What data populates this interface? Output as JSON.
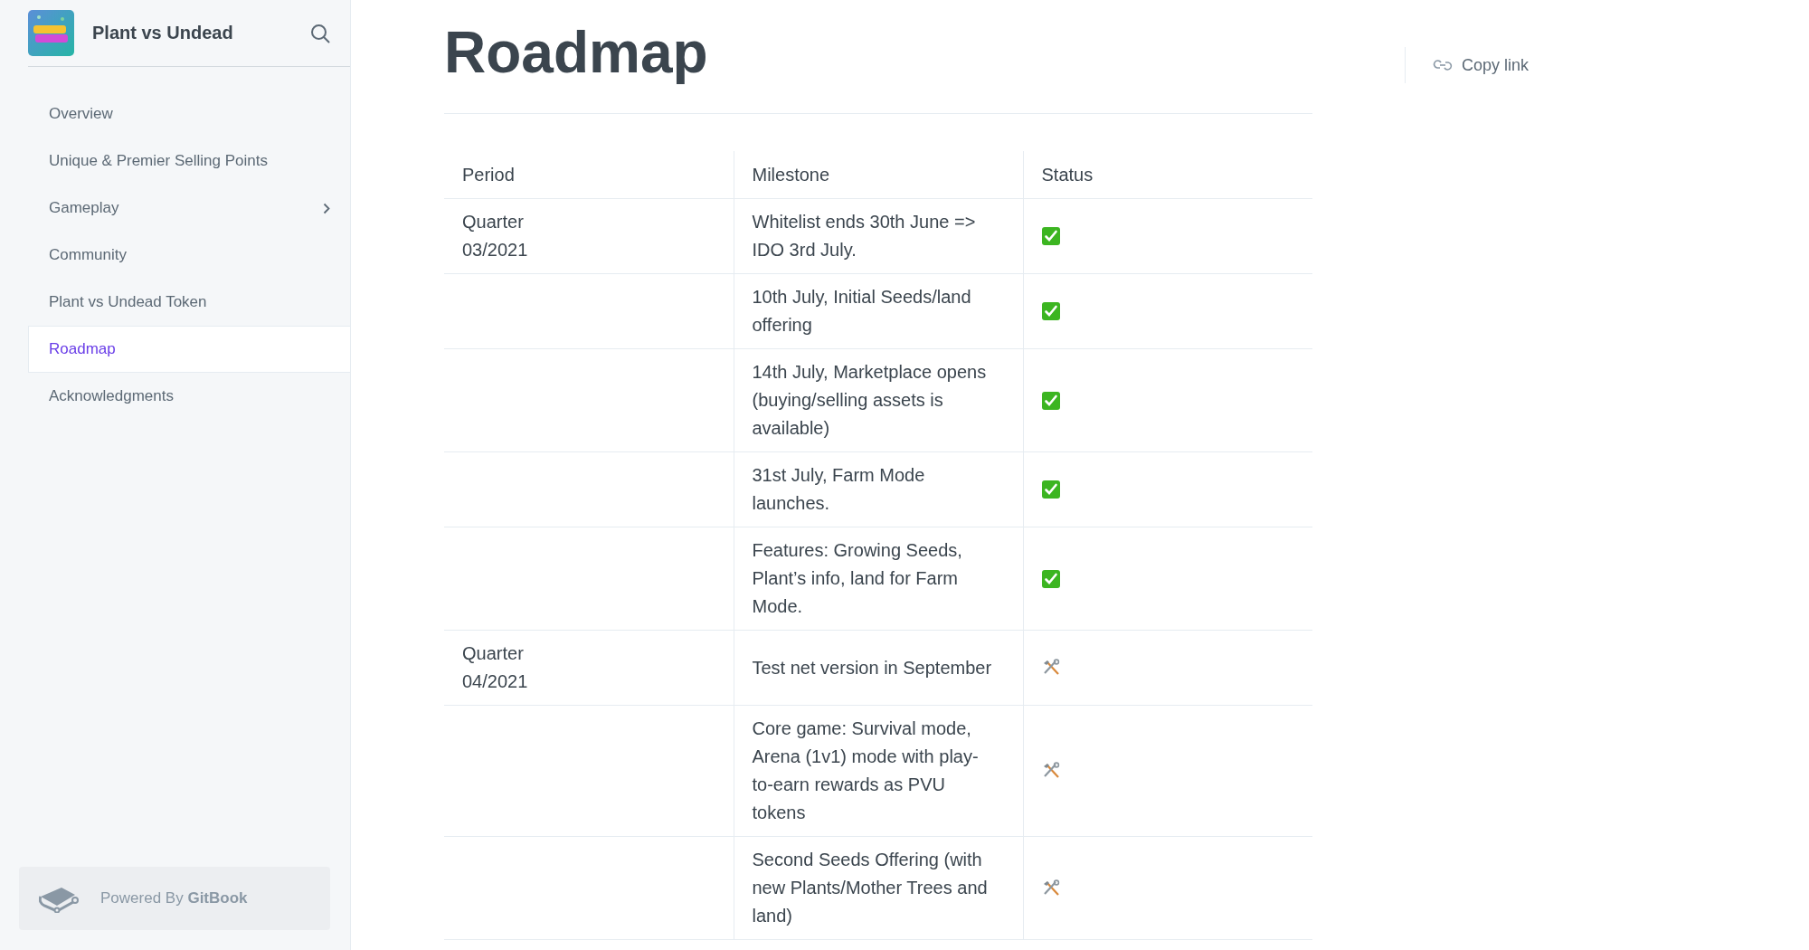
{
  "sidebar": {
    "title": "Plant vs Undead",
    "items": [
      {
        "label": "Overview",
        "selected": false,
        "expandable": false
      },
      {
        "label": "Unique & Premier Selling Points",
        "selected": false,
        "expandable": false
      },
      {
        "label": "Gameplay",
        "selected": false,
        "expandable": true
      },
      {
        "label": "Community",
        "selected": false,
        "expandable": false
      },
      {
        "label": "Plant vs Undead Token",
        "selected": false,
        "expandable": false
      },
      {
        "label": "Roadmap",
        "selected": true,
        "expandable": false
      },
      {
        "label": "Acknowledgments",
        "selected": false,
        "expandable": false
      }
    ],
    "footer": {
      "prefix": "Powered By",
      "brand": "GitBook"
    }
  },
  "page": {
    "title": "Roadmap",
    "copy_link": "Copy link"
  },
  "table": {
    "columns": [
      "Period",
      "Milestone",
      "Status"
    ],
    "rows": [
      {
        "period": "Quarter 03/2021",
        "milestone": "Whitelist ends 30th June => IDO 3rd July.",
        "status": {
          "kind": "done"
        }
      },
      {
        "period": "",
        "milestone": "10th July, Initial Seeds/land offering",
        "status": {
          "kind": "done"
        }
      },
      {
        "period": "",
        "milestone": "14th July, Marketplace opens (buying/selling assets is available)",
        "status": {
          "kind": "done"
        }
      },
      {
        "period": "",
        "milestone": "31st July, Farm Mode launches.",
        "status": {
          "kind": "done"
        }
      },
      {
        "period": "",
        "milestone": "Features: Growing Seeds, Plant’s info, land for Farm Mode.",
        "status": {
          "kind": "done"
        }
      },
      {
        "period": "Quarter 04/2021",
        "milestone": "Test net version in September",
        "status": {
          "kind": "in_progress"
        }
      },
      {
        "period": "",
        "milestone": "Core game: Survival mode, Arena (1v1) mode with play-to-earn rewards as PVU tokens",
        "status": {
          "kind": "in_progress"
        }
      },
      {
        "period": "",
        "milestone": "Second Seeds Offering (with new Plants/Mother Trees and land)",
        "status": {
          "kind": "in_progress"
        }
      }
    ]
  }
}
